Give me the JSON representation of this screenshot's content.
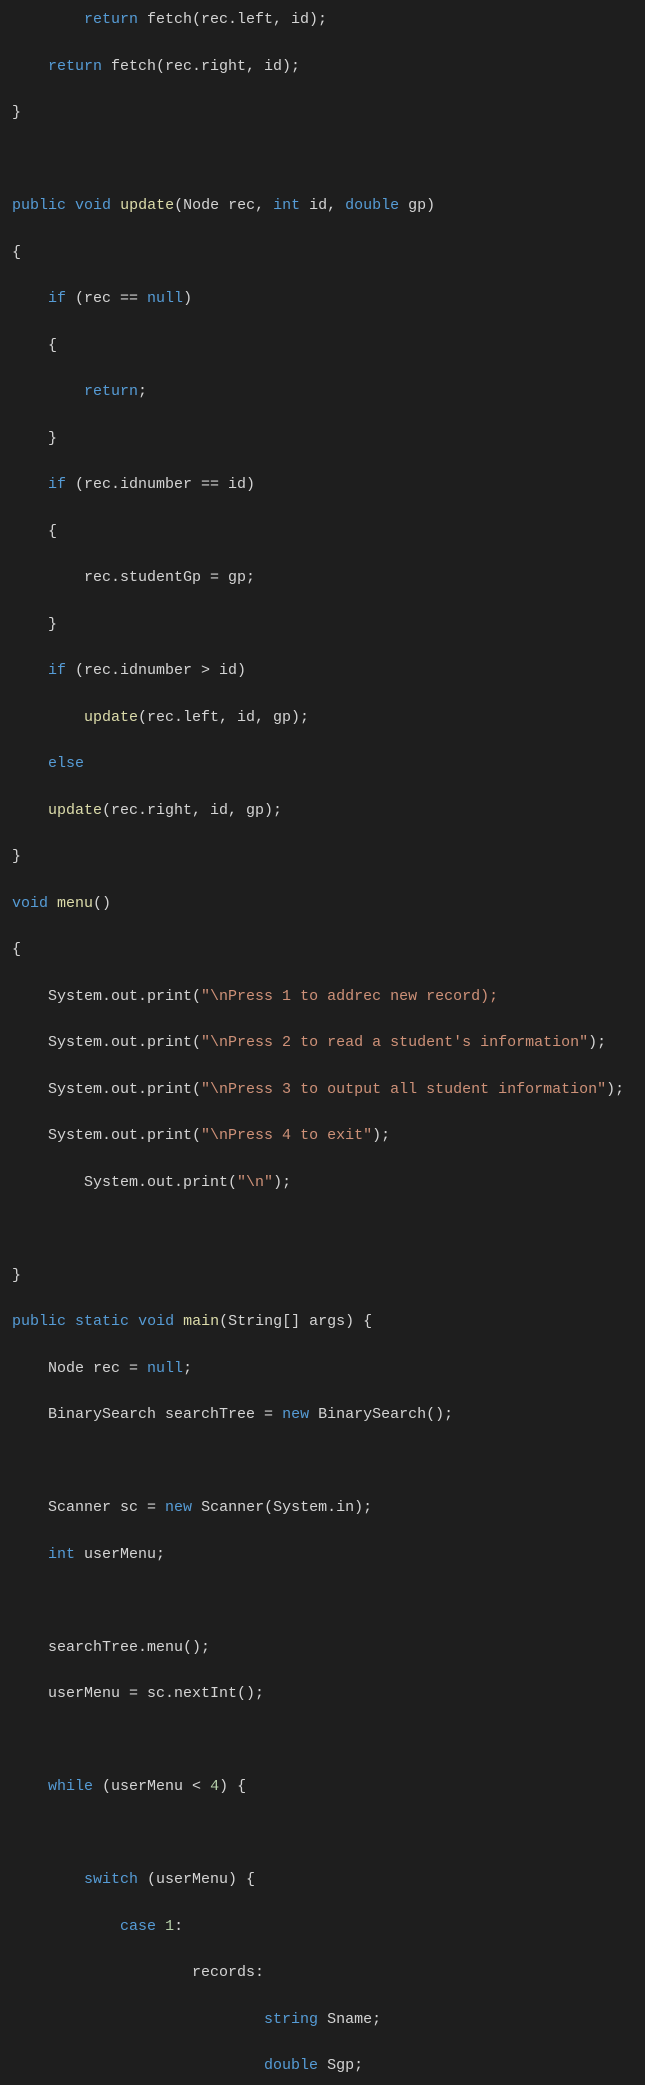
{
  "code": {
    "lines": [
      {
        "text": "        return fetch(rec.left, id);",
        "type": "plain"
      },
      {
        "text": "    return fetch(rec.right, id);",
        "type": "plain"
      },
      {
        "text": "}",
        "type": "plain"
      },
      {
        "text": "",
        "type": "plain"
      },
      {
        "text": "public void update(Node rec, int id, double gp)",
        "type": "signature"
      },
      {
        "text": "{",
        "type": "plain"
      },
      {
        "text": "    if (rec == null)",
        "type": "plain"
      },
      {
        "text": "    {",
        "type": "plain"
      },
      {
        "text": "        return;",
        "type": "plain"
      },
      {
        "text": "    }",
        "type": "plain"
      },
      {
        "text": "    if (rec.idnumber == id)",
        "type": "plain"
      },
      {
        "text": "    {",
        "type": "plain"
      },
      {
        "text": "        rec.studentGp = gp;",
        "type": "plain"
      },
      {
        "text": "    }",
        "type": "plain"
      },
      {
        "text": "    if (rec.idnumber > id)",
        "type": "plain"
      },
      {
        "text": "        update(rec.left, id, gp);",
        "type": "plain"
      },
      {
        "text": "    else",
        "type": "plain"
      },
      {
        "text": "    update(rec.right, id, gp);",
        "type": "plain"
      },
      {
        "text": "}",
        "type": "plain"
      },
      {
        "text": "void menu()",
        "type": "plain"
      },
      {
        "text": "{",
        "type": "plain"
      },
      {
        "text": "    System.out.print(\"\\nPress 1 to addrec new record);",
        "type": "plain"
      },
      {
        "text": "    System.out.print(\"\\nPress 2 to read a student's information\");",
        "type": "plain"
      },
      {
        "text": "    System.out.print(\"\\nPress 3 to output all student information\");",
        "type": "plain"
      },
      {
        "text": "    System.out.print(\"\\nPress 4 to exit\");",
        "type": "plain"
      },
      {
        "text": "        System.out.print(\"\\n\");",
        "type": "plain"
      },
      {
        "text": "",
        "type": "plain"
      },
      {
        "text": "}",
        "type": "plain"
      },
      {
        "text": "public static void main(String[] args) {",
        "type": "plain"
      },
      {
        "text": "    Node rec = null;",
        "type": "plain"
      },
      {
        "text": "    BinarySearch searchTree = new BinarySearch();",
        "type": "plain"
      },
      {
        "text": "",
        "type": "plain"
      },
      {
        "text": "    Scanner sc = new Scanner(System.in);",
        "type": "plain"
      },
      {
        "text": "    int userMenu;",
        "type": "plain"
      },
      {
        "text": "",
        "type": "plain"
      },
      {
        "text": "    searchTree.menu();",
        "type": "plain"
      },
      {
        "text": "    userMenu = sc.nextInt();",
        "type": "plain"
      },
      {
        "text": "",
        "type": "plain"
      },
      {
        "text": "    while (userMenu < 4) {",
        "type": "plain"
      },
      {
        "text": "",
        "type": "plain"
      },
      {
        "text": "        switch (userMenu) {",
        "type": "plain"
      },
      {
        "text": "            case 1:",
        "type": "plain"
      },
      {
        "text": "                    records:",
        "type": "plain"
      },
      {
        "text": "                            string Sname;",
        "type": "plain"
      },
      {
        "text": "                            double Sgp;",
        "type": "plain"
      }
    ]
  }
}
